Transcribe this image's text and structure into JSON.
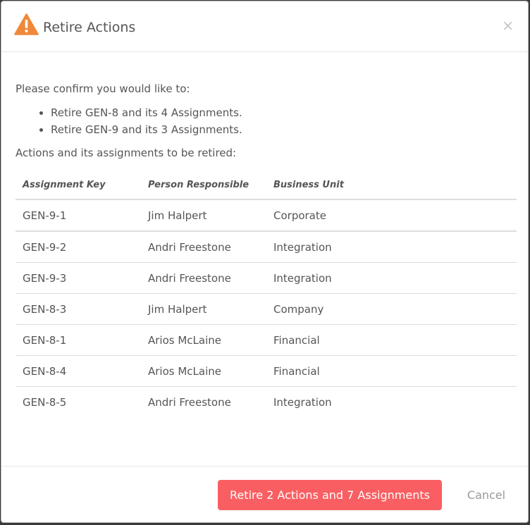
{
  "dialog": {
    "title": "Retire Actions",
    "close_symbol": "×",
    "warning_icon": "warning-triangle-icon",
    "warning_color": "#f0883a"
  },
  "body": {
    "confirm_text": "Please confirm you would like to:",
    "bullets": [
      "Retire GEN-8 and its 4 Assignments.",
      "Retire GEN-9 and its 3 Assignments."
    ],
    "retire_label": "Actions and its assignments to be retired:"
  },
  "table": {
    "headers": [
      "Assignment Key",
      "Person Responsible",
      "Business Unit"
    ],
    "rows": [
      [
        "GEN-9-1",
        "Jim Halpert",
        "Corporate"
      ],
      [
        "GEN-9-2",
        "Andri Freestone",
        "Integration"
      ],
      [
        "GEN-9-3",
        "Andri Freestone",
        "Integration"
      ],
      [
        "GEN-8-3",
        "Jim Halpert",
        "Company"
      ],
      [
        "GEN-8-1",
        "Arios McLaine",
        "Financial"
      ],
      [
        "GEN-8-4",
        "Arios McLaine",
        "Financial"
      ],
      [
        "GEN-8-5",
        "Andri Freestone",
        "Integration"
      ]
    ]
  },
  "footer": {
    "retire_button": "Retire 2 Actions and 7 Assignments",
    "cancel_button": "Cancel",
    "retire_color": "#f95f62"
  }
}
